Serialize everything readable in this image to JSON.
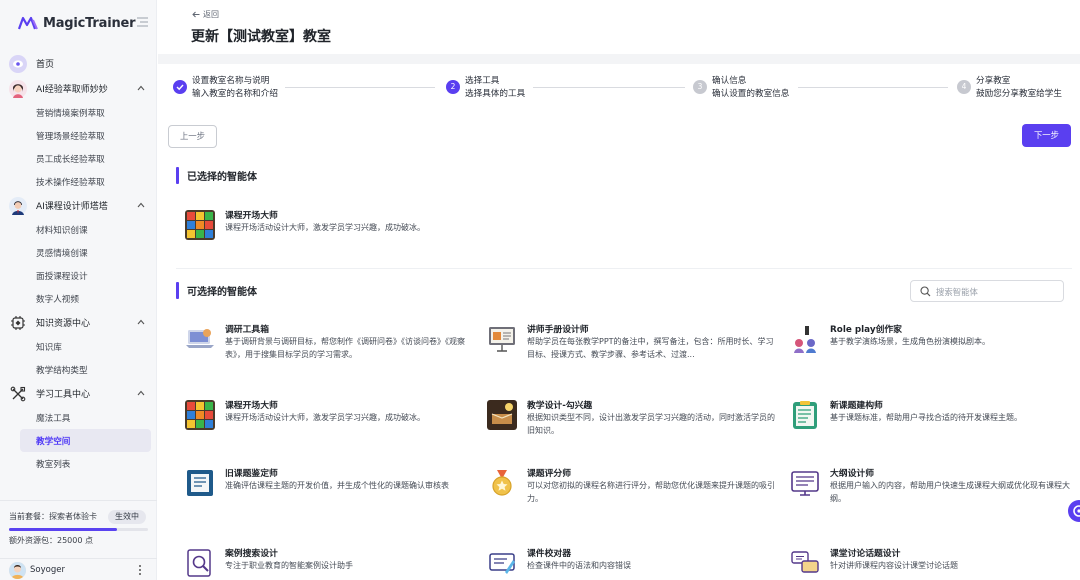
{
  "app": {
    "logo_text": "MagicTrainer"
  },
  "sidebar": {
    "home": "首页",
    "groups": [
      {
        "label": "AI经验萃取师妙妙",
        "items": [
          "营销情境案例萃取",
          "管理场景经验萃取",
          "员工成长经验萃取",
          "技术操作经验萃取"
        ]
      },
      {
        "label": "AI课程设计师塔塔",
        "items": [
          "材料知识创课",
          "灵感情境创课",
          "面授课程设计",
          "数字人视频"
        ]
      },
      {
        "label": "知识资源中心",
        "items": [
          "知识库",
          "教学结构类型"
        ]
      },
      {
        "label": "学习工具中心",
        "items": [
          "魔法工具",
          "教学空间",
          "教室列表"
        ]
      }
    ],
    "active_item": "教学空间",
    "plan": {
      "label": "当前套餐：探索者体验卡",
      "badge": "生效中",
      "extra": "额外资源包：25000 点",
      "progress": 0.78
    },
    "user": {
      "name": "Soyoger"
    }
  },
  "header": {
    "back": "返回",
    "title": "更新【测试教室】教室"
  },
  "steps": [
    {
      "num": "",
      "title": "设置教室名称与说明",
      "desc": "输入教室的名称和介绍",
      "state": "done"
    },
    {
      "num": "2",
      "title": "选择工具",
      "desc": "选择具体的工具",
      "state": "active"
    },
    {
      "num": "3",
      "title": "确认信息",
      "desc": "确认设置的教室信息",
      "state": "todo"
    },
    {
      "num": "4",
      "title": "分享教室",
      "desc": "鼓励您分享教室给学生",
      "state": "todo"
    }
  ],
  "buttons": {
    "prev": "上一步",
    "next": "下一步"
  },
  "selected": {
    "title": "已选择的智能体",
    "cards": [
      {
        "title": "课程开场大师",
        "desc": "课程开场活动设计大师，激发学员学习兴趣，成功破冰。",
        "icon": "rubiks-cube-icon"
      }
    ]
  },
  "available": {
    "title": "可选择的智能体",
    "search_placeholder": "搜索智能体",
    "cards": [
      {
        "title": "调研工具箱",
        "desc": "基于调研背景与调研目标，帮您制作《调研问卷》《访谈问卷》《观察表》，用于搜集目标学员的学习需求。",
        "icon": "survey-laptop-icon"
      },
      {
        "title": "讲师手册设计师",
        "desc": "帮助学员在每张教学PPT的备注中，撰写备注，包含：所用时长、学习目标、授课方式、教学步骤、参考话术、过渡...",
        "icon": "slides-icon"
      },
      {
        "title": "Role play创作家",
        "desc": "基于教学演练场景，生成角色扮演模拟剧本。",
        "icon": "role-play-icon"
      },
      {
        "title": "课程开场大师",
        "desc": "课程开场活动设计大师，激发学员学习兴趣，成功破冰。",
        "icon": "rubiks-cube-icon"
      },
      {
        "title": "教学设计-勾兴趣",
        "desc": "根据知识类型不同，设计出激发学员学习兴趣的活动，同时激活学员的旧知识。",
        "icon": "book-lamp-icon"
      },
      {
        "title": "新课题建构师",
        "desc": "基于课题标准，帮助用户寻找合适的待开发课程主题。",
        "icon": "checklist-board-icon"
      },
      {
        "title": "旧课题鉴定师",
        "desc": "准确评估课程主题的开发价值，并生成个性化的课题确认审核表",
        "icon": "document-icon"
      },
      {
        "title": "课题评分师",
        "desc": "可以对您初拟的课程名称进行评分，帮助您优化课题来提升课题的吸引力。",
        "icon": "medal-icon"
      },
      {
        "title": "大纲设计师",
        "desc": "根据用户输入的内容，帮助用户快速生成课程大纲或优化现有课程大纲。",
        "icon": "outline-screen-icon"
      },
      {
        "title": "案例搜索设计",
        "desc": "专注于职业教育的智能案例设计助手",
        "icon": "case-search-icon"
      },
      {
        "title": "课件校对器",
        "desc": "检查课件中的语法和内容错误",
        "icon": "proofread-icon"
      },
      {
        "title": "课堂讨论话题设计",
        "desc": "针对讲师课程内容设计课堂讨论话题",
        "icon": "discussion-icon"
      }
    ]
  },
  "colors": {
    "accent": "#5a3ff0",
    "sidebar_bg": "#f6f7f9"
  }
}
